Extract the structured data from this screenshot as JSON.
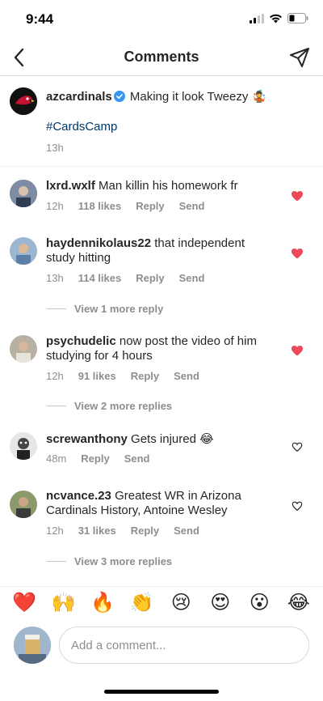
{
  "status": {
    "time": "9:44"
  },
  "header": {
    "title": "Comments"
  },
  "post": {
    "username": "azcardinals",
    "caption": "Making it look Tweezy 🤹",
    "hashtag": "#CardsCamp",
    "time": "13h"
  },
  "comments": [
    {
      "username": "lxrd.wxlf",
      "text": "Man killin his homework fr",
      "time": "12h",
      "likes": "118 likes",
      "reply": "Reply",
      "send": "Send",
      "liked": true,
      "view_replies": ""
    },
    {
      "username": "haydennikolaus22",
      "text": "that independent study hitting",
      "time": "13h",
      "likes": "114 likes",
      "reply": "Reply",
      "send": "Send",
      "liked": true,
      "view_replies": "View 1 more reply"
    },
    {
      "username": "psychudelic",
      "text": "now post the video of him studying for 4 hours",
      "time": "12h",
      "likes": "91 likes",
      "reply": "Reply",
      "send": "Send",
      "liked": true,
      "view_replies": "View 2 more replies"
    },
    {
      "username": "screwanthony",
      "text": "Gets injured 😂",
      "time": "48m",
      "likes": "",
      "reply": "Reply",
      "send": "Send",
      "liked": false,
      "view_replies": ""
    },
    {
      "username": "ncvance.23",
      "text": "Greatest WR in Arizona Cardinals History, Antoine Wesley",
      "time": "12h",
      "likes": "31 likes",
      "reply": "Reply",
      "send": "Send",
      "liked": false,
      "view_replies": "View 3 more replies"
    }
  ],
  "emojis": [
    "❤️",
    "🙌",
    "🔥",
    "👏",
    "😢",
    "😍",
    "😮",
    "😂"
  ],
  "composer": {
    "placeholder": "Add a comment..."
  },
  "colors": {
    "like_red": "#ed4956",
    "hashtag_blue": "#00376b",
    "verified_blue": "#3897f0",
    "muted_gray": "#8e8e8e"
  }
}
